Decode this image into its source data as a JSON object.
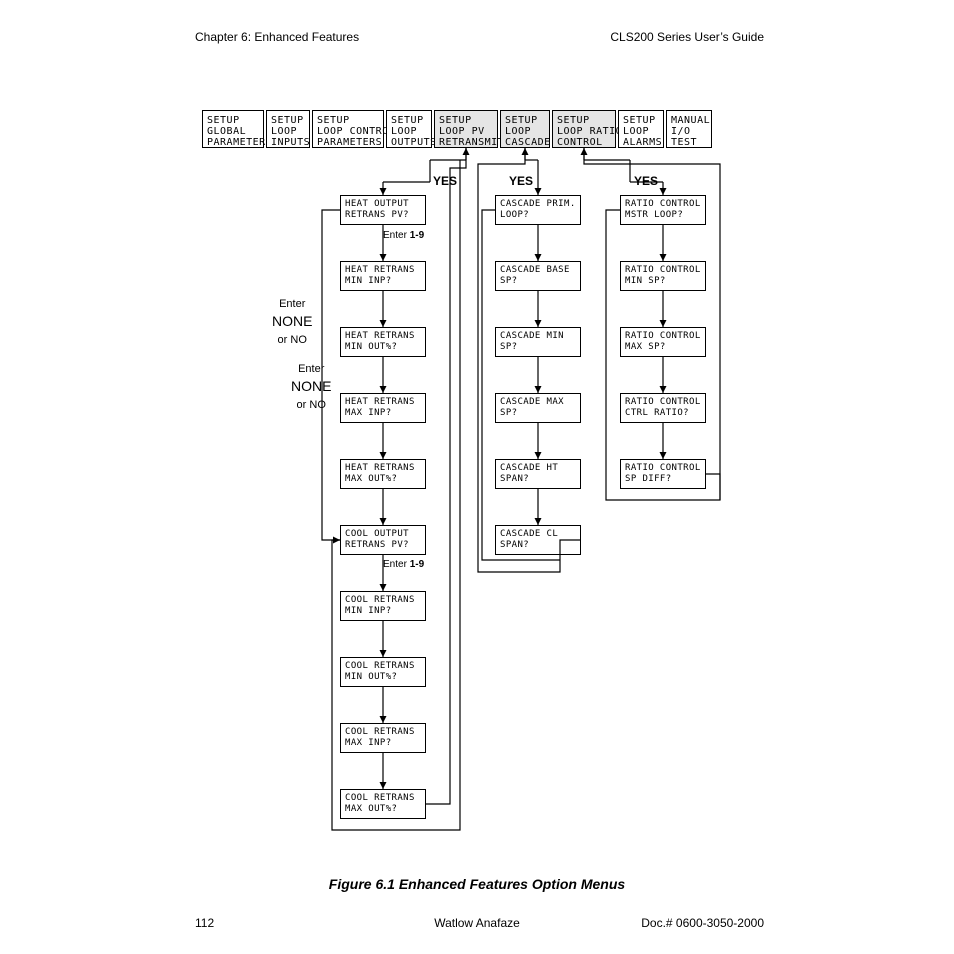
{
  "header": {
    "left": "Chapter 6: Enhanced Features",
    "right": "CLS200 Series User’s Guide"
  },
  "footer": {
    "left": "112",
    "center": "Watlow Anafaze",
    "right": "Doc.# 0600-3050-2000"
  },
  "caption": "Figure 6.1    Enhanced Features Option Menus",
  "menus": {
    "m0": "SETUP\nGLOBAL\nPARAMETERS",
    "m1": "SETUP\nLOOP\nINPUTS",
    "m2": "SETUP\nLOOP CONTROL\nPARAMETERS",
    "m3": "SETUP\nLOOP\nOUTPUTS",
    "m4": "SETUP\nLOOP PV\nRETRANSMIT",
    "m5": "SETUP\nLOOP\nCASCADE",
    "m6": "SETUP\nLOOP RATIO\nCONTROL",
    "m7": "SETUP\nLOOP\nALARMS",
    "m8": "MANUAL\nI/O\nTEST"
  },
  "labels": {
    "yes": "YES",
    "enter19_pre": "Enter ",
    "enter19_bold": "1-9",
    "noneno_line1": "Enter",
    "noneno_line2": "NONE",
    "noneno_line3": "or NO"
  },
  "colA": {
    "a0": "HEAT OUTPUT\nRETRANS PV?",
    "a1": "HEAT RETRANS\nMIN INP?",
    "a2": "HEAT RETRANS\nMIN OUT%?",
    "a3": "HEAT RETRANS\nMAX INP?",
    "a4": "HEAT RETRANS\nMAX OUT%?",
    "a5": "COOL OUTPUT\nRETRANS PV?",
    "a6": "COOL RETRANS\nMIN INP?",
    "a7": "COOL RETRANS\nMIN OUT%?",
    "a8": "COOL RETRANS\nMAX INP?",
    "a9": "COOL RETRANS\nMAX OUT%?"
  },
  "colB": {
    "b0": "CASCADE\nPRIM. LOOP?",
    "b1": "CASCADE\nBASE SP?",
    "b2": "CASCADE\nMIN SP?",
    "b3": "CASCADE\nMAX SP?",
    "b4": "CASCADE\nHT SPAN?",
    "b5": "CASCADE\nCL SPAN?"
  },
  "colC": {
    "c0": "RATIO CONTROL\nMSTR LOOP?",
    "c1": "RATIO CONTROL\nMIN SP?",
    "c2": "RATIO CONTROL\nMAX SP?",
    "c3": "RATIO CONTROL\nCTRL RATIO?",
    "c4": "RATIO CONTROL\nSP DIFF?"
  }
}
